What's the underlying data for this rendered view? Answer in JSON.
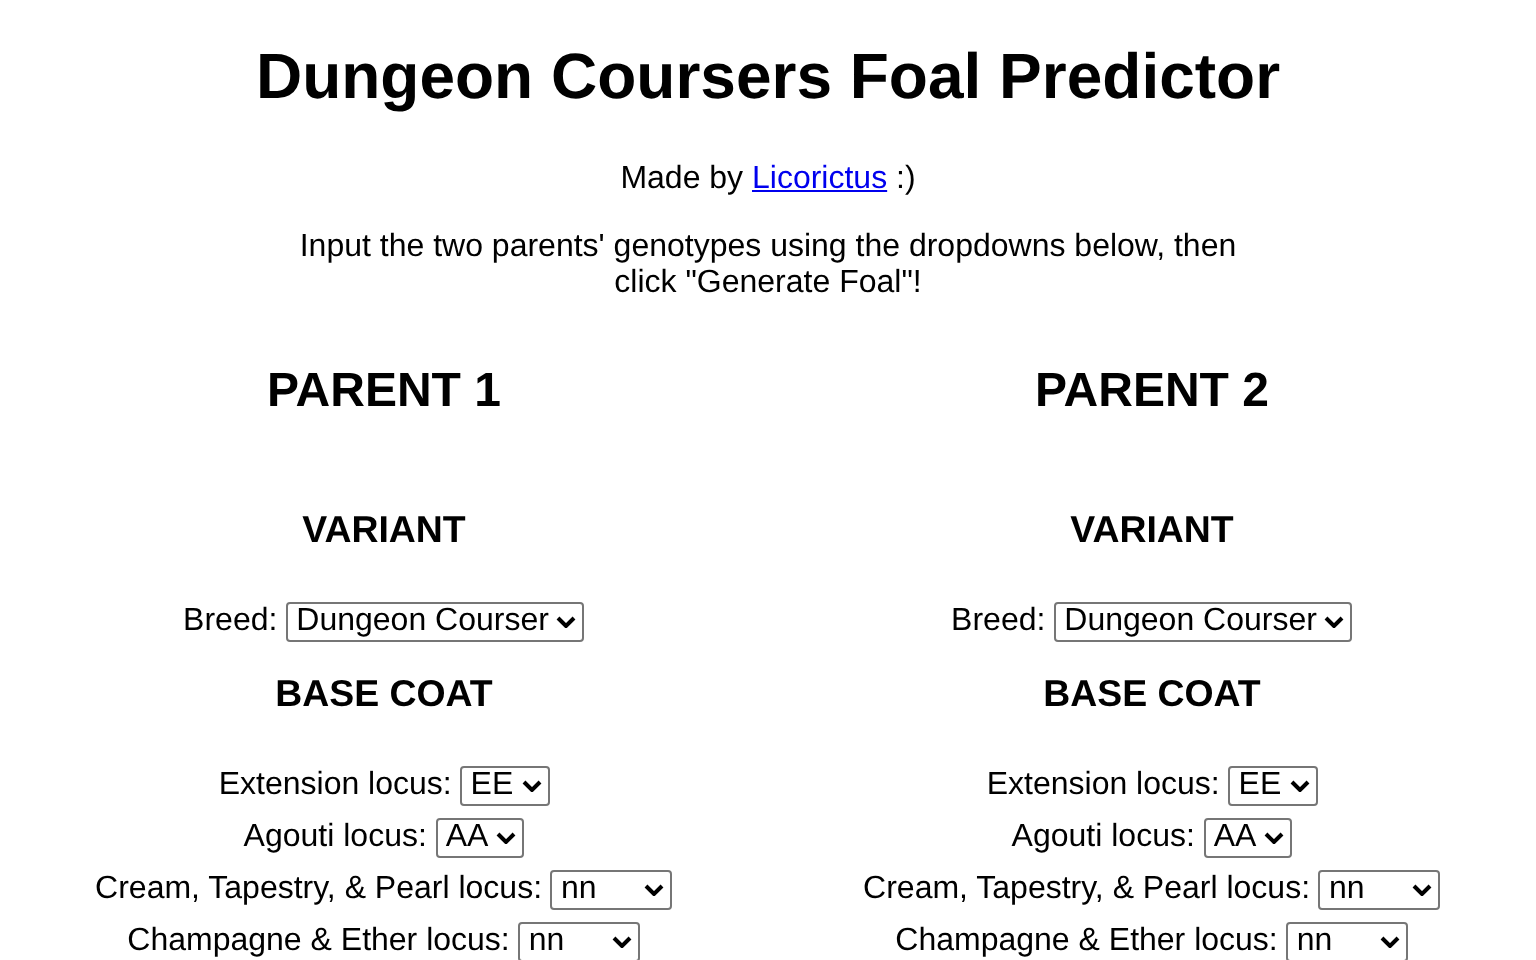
{
  "title": "Dungeon Coursers Foal Predictor",
  "credit": {
    "prefix": "Made by",
    "link": "Licorictus",
    "suffix": ":)"
  },
  "instructions": "Input the two parents' genotypes using the dropdowns below, then click \"Generate Foal\"!",
  "parents": [
    {
      "heading": "PARENT 1",
      "sections": [
        {
          "heading": "VARIANT",
          "fields": [
            {
              "label": "Breed:",
              "value": "Dungeon Courser",
              "kind": "auto"
            }
          ]
        },
        {
          "heading": "BASE COAT",
          "fields": [
            {
              "label": "Extension locus:",
              "value": "EE",
              "kind": "auto"
            },
            {
              "label": "Agouti locus:",
              "value": "AA",
              "kind": "auto"
            },
            {
              "label": "Cream, Tapestry, & Pearl locus:",
              "value": "nn",
              "kind": "wide"
            },
            {
              "label": "Champagne & Ether locus:",
              "value": "nn",
              "kind": "wide"
            }
          ]
        }
      ]
    },
    {
      "heading": "PARENT 2",
      "sections": [
        {
          "heading": "VARIANT",
          "fields": [
            {
              "label": "Breed:",
              "value": "Dungeon Courser",
              "kind": "auto"
            }
          ]
        },
        {
          "heading": "BASE COAT",
          "fields": [
            {
              "label": "Extension locus:",
              "value": "EE",
              "kind": "auto"
            },
            {
              "label": "Agouti locus:",
              "value": "AA",
              "kind": "auto"
            },
            {
              "label": "Cream, Tapestry, & Pearl locus:",
              "value": "nn",
              "kind": "wide"
            },
            {
              "label": "Champagne & Ether locus:",
              "value": "nn",
              "kind": "wide"
            }
          ]
        }
      ]
    }
  ]
}
